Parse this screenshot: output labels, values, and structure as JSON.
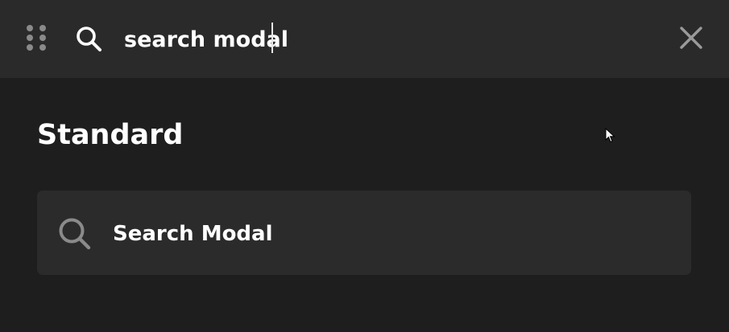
{
  "search": {
    "value": "search modal",
    "icon": "search-icon"
  },
  "toolbar": {
    "drag_icon": "drag-handle-icon",
    "close_icon": "close-icon"
  },
  "results": {
    "section_title": "Standard",
    "items": [
      {
        "label": "Search Modal",
        "icon": "search-icon"
      }
    ]
  },
  "colors": {
    "background": "#1e1e1e",
    "header_background": "#2a2a2a",
    "item_background": "#2b2b2b",
    "text": "#ffffff",
    "icon_muted": "#8a8a8a"
  }
}
